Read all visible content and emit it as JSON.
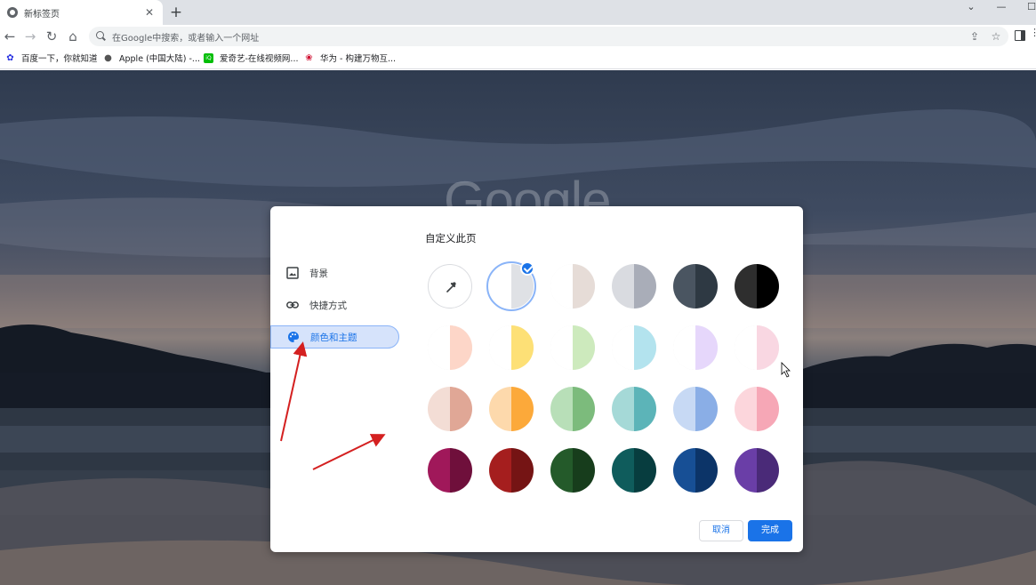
{
  "tab": {
    "title": "新标签页"
  },
  "omnibox": {
    "placeholder": "在Google中搜索，或者输入一个网址"
  },
  "bookmarks": [
    {
      "label": "百度一下，你就知道",
      "icon": "baidu-icon"
    },
    {
      "label": "Apple (中国大陆) -...",
      "icon": "apple-icon"
    },
    {
      "label": "爱奇艺-在线视频网...",
      "icon": "iqiyi-icon"
    },
    {
      "label": "华为 - 构建万物互...",
      "icon": "huawei-icon"
    }
  ],
  "background": {
    "logo_text": "Google"
  },
  "dialog": {
    "title": "自定义此页",
    "nav": [
      {
        "label": "背景",
        "icon": "background-image-icon"
      },
      {
        "label": "快捷方式",
        "icon": "link-icon"
      },
      {
        "label": "颜色和主题",
        "icon": "palette-icon",
        "active": true
      }
    ],
    "swatches": [
      [
        {
          "type": "picker",
          "icon": "eyedropper-icon"
        },
        {
          "left": "#ffffff",
          "right": "#dfe1e5",
          "selected": true
        },
        {
          "left": "#ffffff",
          "right": "#e6dcd7"
        },
        {
          "left": "#d9dbe0",
          "right": "#a9adb8"
        },
        {
          "left": "#4a5561",
          "right": "#2e3943"
        },
        {
          "left": "#2e2e2e",
          "right": "#000000"
        }
      ],
      [
        {
          "left": "#ffffff",
          "right": "#fdd6c8"
        },
        {
          "left": "#ffffff",
          "right": "#fde076"
        },
        {
          "left": "#ffffff",
          "right": "#cdeabd"
        },
        {
          "left": "#ffffff",
          "right": "#b3e3ee"
        },
        {
          "left": "#ffffff",
          "right": "#e6d7fb"
        },
        {
          "left": "#ffffff",
          "right": "#f9d7e2"
        }
      ],
      [
        {
          "left": "#f3ddd5",
          "right": "#e0a796"
        },
        {
          "left": "#fdd9ac",
          "right": "#fca93a"
        },
        {
          "left": "#b8dfb8",
          "right": "#7cbb7c"
        },
        {
          "left": "#a5d9d7",
          "right": "#5cb4b8"
        },
        {
          "left": "#c7d9f4",
          "right": "#8aaee6"
        },
        {
          "left": "#fcd6dc",
          "right": "#f6a7b6"
        }
      ],
      [
        {
          "left": "#a0185a",
          "right": "#6f0f3b"
        },
        {
          "left": "#a51e1e",
          "right": "#751414"
        },
        {
          "left": "#245a2a",
          "right": "#173d1c"
        },
        {
          "left": "#0f5c5c",
          "right": "#073d3f"
        },
        {
          "left": "#174f95",
          "right": "#0c3468"
        },
        {
          "left": "#6a3ea7",
          "right": "#4a2a78"
        }
      ]
    ],
    "cancel_label": "取消",
    "done_label": "完成"
  }
}
